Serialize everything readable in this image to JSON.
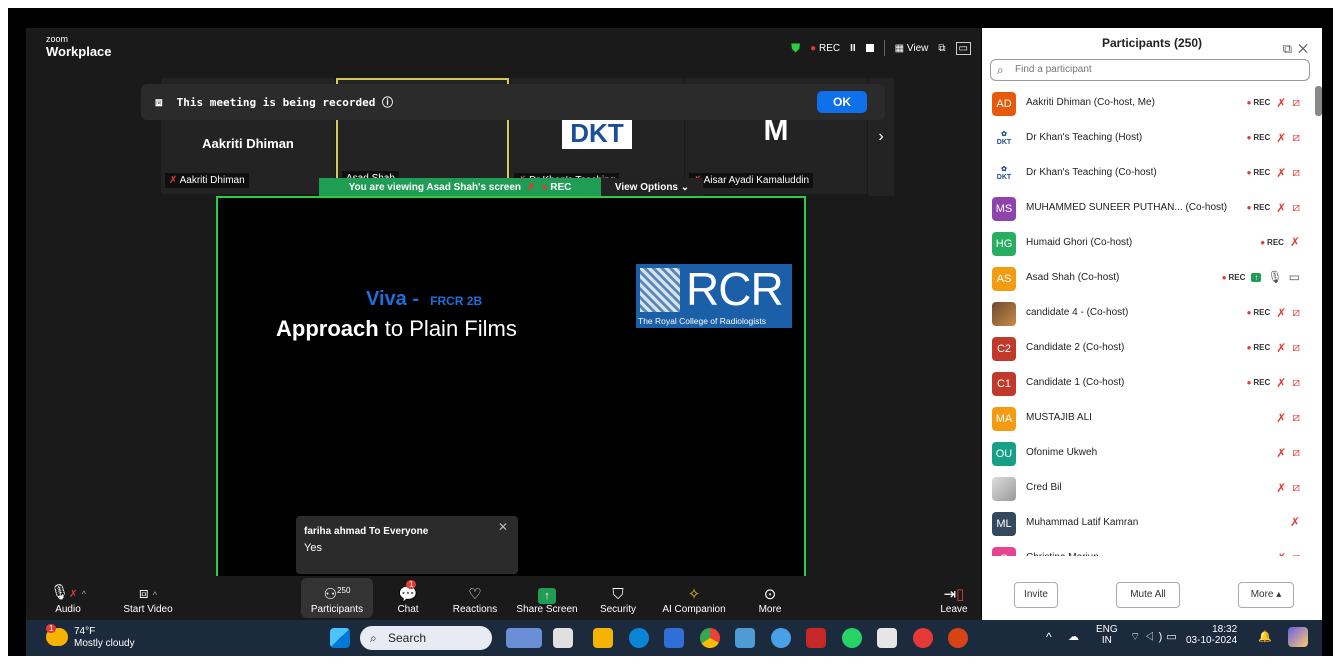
{
  "app": {
    "brand_small": "zoom",
    "brand_big": "Workplace"
  },
  "topbar": {
    "rec_label": "REC",
    "pause": "II",
    "view_label": "View"
  },
  "banner": {
    "text": "This meeting is being recorded ⓘ",
    "ok_label": "OK"
  },
  "tiles": [
    {
      "name": "Aakriti Dhiman",
      "big": "Aakriti Dhiman"
    },
    {
      "name": "Asad Shah"
    },
    {
      "name": "Dr Khan's Teaching",
      "big": "DKT"
    },
    {
      "name": "Aisar Ayadi Kamaluddin",
      "big": "M"
    }
  ],
  "viewing": {
    "text": "You are viewing  Asad Shah's screen",
    "rec": "REC",
    "options": "View Options"
  },
  "slide": {
    "viva": "Viva -",
    "viva_tag": "FRCR 2B",
    "title_bold": "Approach",
    "title_rest": " to Plain Films",
    "logo_big": "RCR",
    "logo_sub": "The Royal College of Radiologists"
  },
  "chat_popup": {
    "from": "fariha ahmad To Everyone",
    "message": "Yes"
  },
  "toolbar": {
    "audio": "Audio",
    "start_video": "Start Video",
    "participants": "Participants",
    "participants_count": "250",
    "chat": "Chat",
    "chat_badge": "1",
    "reactions": "Reactions",
    "share_screen": "Share Screen",
    "security": "Security",
    "ai_companion": "AI Companion",
    "more": "More",
    "leave": "Leave"
  },
  "panel": {
    "title": "Participants (250)",
    "search_placeholder": "Find a participant",
    "participants": [
      {
        "initials": "AD",
        "color": "#e8590c",
        "name": "Aakriti Dhiman (Co-host, Me)",
        "rec": "REC",
        "mic": "off",
        "video": "off"
      },
      {
        "initials": "DKT",
        "avatar": "dkt",
        "name": "Dr Khan's Teaching (Host)",
        "rec": "REC",
        "mic": "off",
        "video": "off"
      },
      {
        "initials": "DKT",
        "avatar": "dkt",
        "name": "Dr Khan's Teaching (Co-host)",
        "rec": "REC",
        "mic": "off",
        "video": "off"
      },
      {
        "initials": "MS",
        "color": "#8e44ad",
        "name": "MUHAMMED SUNEER PUTHAN... (Co-host)",
        "rec": "REC",
        "mic": "off",
        "video": "off"
      },
      {
        "initials": "HG",
        "color": "#27ae60",
        "name": "Humaid Ghori (Co-host)",
        "rec": "REC",
        "mic": "off",
        "video": ""
      },
      {
        "initials": "AS",
        "color": "#f39c12",
        "name": "Asad Shah (Co-host)",
        "rec": "REC",
        "mic": "on",
        "video": "on",
        "sharing": true
      },
      {
        "initials": "",
        "avatar": "img",
        "name": "candidate 4 - (Co-host)",
        "rec": "REC",
        "mic": "off",
        "video": "off"
      },
      {
        "initials": "C2",
        "color": "#c0392b",
        "name": "Candidate 2 (Co-host)",
        "rec": "REC",
        "mic": "off",
        "video": "off"
      },
      {
        "initials": "C1",
        "color": "#c0392b",
        "name": "Candidate 1 (Co-host)",
        "rec": "REC",
        "mic": "off",
        "video": "off"
      },
      {
        "initials": "MA",
        "color": "#f39c12",
        "name": "MUSTAJIB ALI",
        "rec": "",
        "mic": "off",
        "video": "off"
      },
      {
        "initials": "OU",
        "color": "#16a085",
        "name": "Ofonime Ukweh",
        "rec": "",
        "mic": "off",
        "video": "off"
      },
      {
        "initials": "",
        "avatar": "img2",
        "name": "Cred Bil",
        "rec": "",
        "mic": "off",
        "video": "off"
      },
      {
        "initials": "ML",
        "color": "#34495e",
        "name": "Muhammad Latif Kamran",
        "rec": "",
        "mic": "off",
        "video": ""
      },
      {
        "initials": "C",
        "color": "#e84393",
        "name": "Christina Mariun",
        "rec": "",
        "mic": "off",
        "video": "off"
      }
    ],
    "invite": "Invite",
    "mute_all": "Mute All",
    "more": "More ▴"
  },
  "taskbar": {
    "weather_temp": "74°F",
    "weather_desc": "Mostly cloudy",
    "weather_badge": "1",
    "search": "Search",
    "lang_top": "ENG",
    "lang_bottom": "IN",
    "time": "18:32",
    "date": "03-10-2024"
  }
}
